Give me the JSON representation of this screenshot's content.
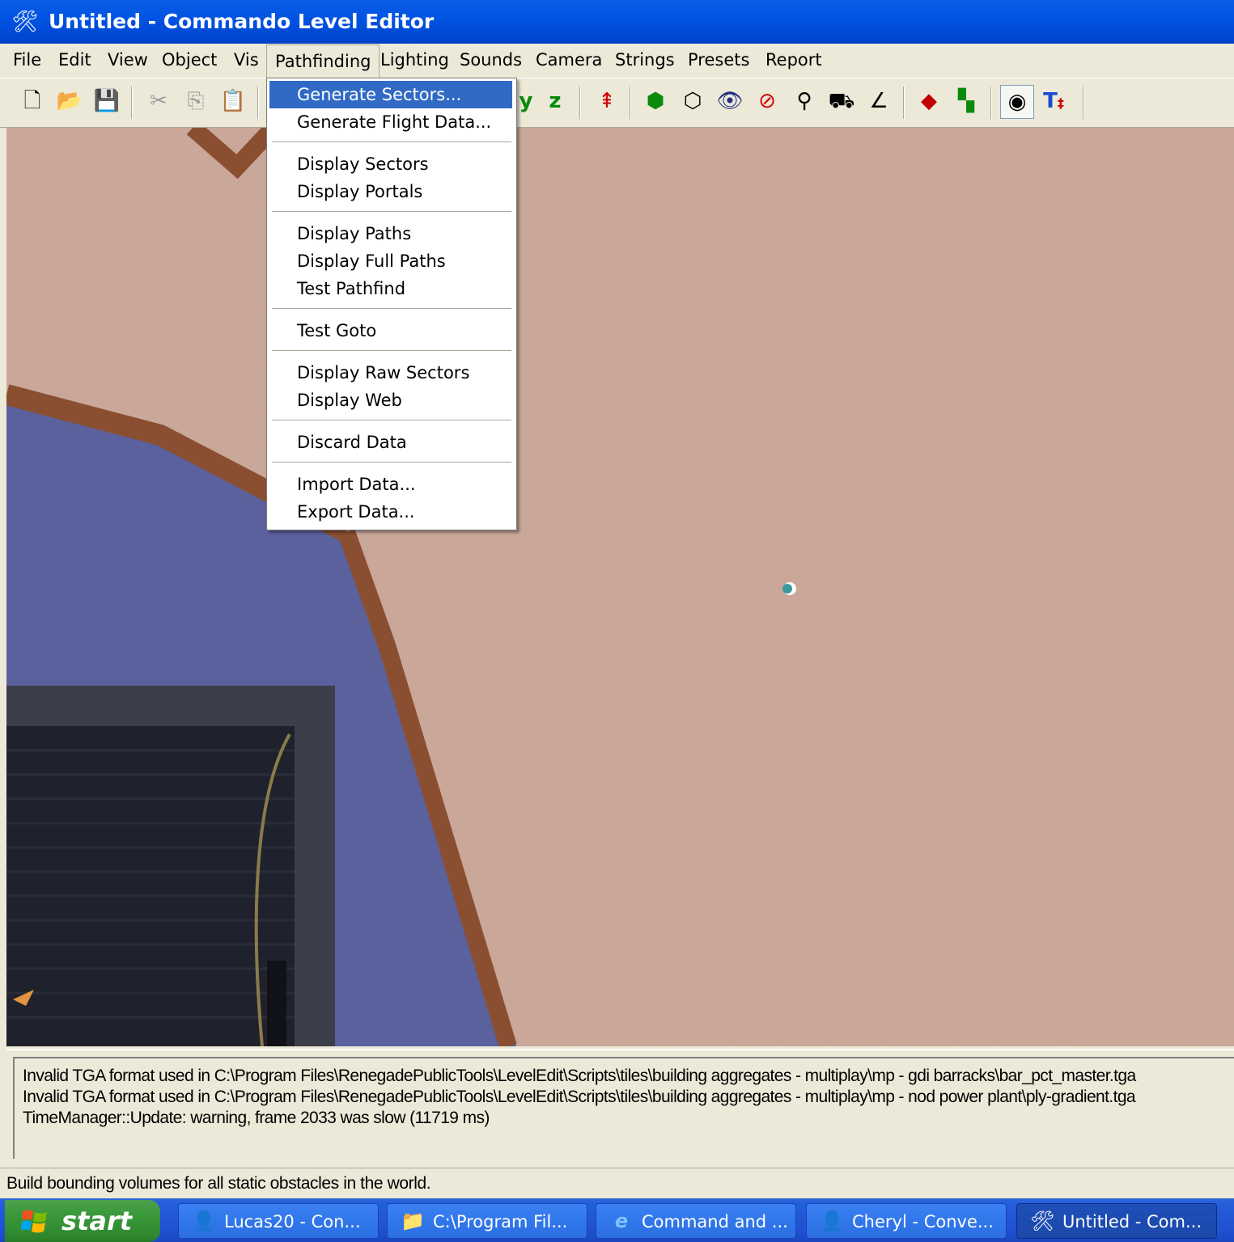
{
  "window": {
    "title": "Untitled - Commando Level Editor",
    "icon": "tools-icon"
  },
  "menubar": {
    "items": [
      "File",
      "Edit",
      "View",
      "Object",
      "Vis",
      "Pathfinding",
      "Lighting",
      "Sounds",
      "Camera",
      "Strings",
      "Presets",
      "Report"
    ],
    "open": "Pathfinding"
  },
  "toolbar": {
    "buttons": [
      "new-icon",
      "open-icon",
      "save-icon",
      "cut-icon",
      "copy-icon",
      "paste-icon",
      "axis-y-icon",
      "axis-z-icon",
      "drop-icon",
      "solid-cube-icon",
      "wire-cube-icon",
      "eye-icon",
      "eye-red-icon",
      "gun-icon",
      "vehicle-icon",
      "angle-icon",
      "color-cube-icon",
      "color-blocks-icon",
      "camera-eye-icon",
      "text-cursor-icon"
    ],
    "axis_z_label": "z",
    "axis_y_label": "y"
  },
  "dropdown": {
    "items": [
      {
        "label": "Generate Sectors...",
        "highlighted": true
      },
      {
        "label": "Generate Flight Data..."
      },
      {
        "label": "Display Sectors"
      },
      {
        "label": "Display Portals"
      },
      {
        "label": "Display Paths"
      },
      {
        "label": "Display Full Paths"
      },
      {
        "label": "Test Pathfind"
      },
      {
        "label": "Test Goto"
      },
      {
        "label": "Display Raw Sectors"
      },
      {
        "label": "Display Web"
      },
      {
        "label": "Discard Data"
      },
      {
        "label": "Import Data..."
      },
      {
        "label": "Export Data..."
      }
    ]
  },
  "output": {
    "lines": [
      "Invalid TGA format used in C:\\Program Files\\RenegadePublicTools\\LevelEdit\\Scripts\\tiles\\building aggregates - multiplay\\mp - gdi barracks\\bar_pct_master.tga",
      "Invalid TGA format used in C:\\Program Files\\RenegadePublicTools\\LevelEdit\\Scripts\\tiles\\building aggregates - multiplay\\mp - nod power plant\\ply-gradient.tga",
      "TimeManager::Update: warning, frame 2033 was slow (11719 ms)"
    ]
  },
  "status": {
    "text": "Build bounding volumes for all static obstacles in the world."
  },
  "taskbar": {
    "start_label": "start",
    "tasks": [
      {
        "label": "Lucas20 - Con...",
        "icon": "messenger-icon"
      },
      {
        "label": "C:\\Program Fil...",
        "icon": "folder-icon"
      },
      {
        "label": "Command and ...",
        "icon": "ie-icon"
      },
      {
        "label": "Cheryl - Conve...",
        "icon": "messenger-icon"
      },
      {
        "label": "Untitled - Com...",
        "icon": "tools-icon",
        "active": true
      }
    ]
  },
  "colors": {
    "titlebar": "#0054e3",
    "menu_highlight": "#316ac5",
    "terrain": "#c9a596",
    "wall": "#595f9b",
    "taskbar": "#245edb",
    "start": "#3c9a3c"
  }
}
